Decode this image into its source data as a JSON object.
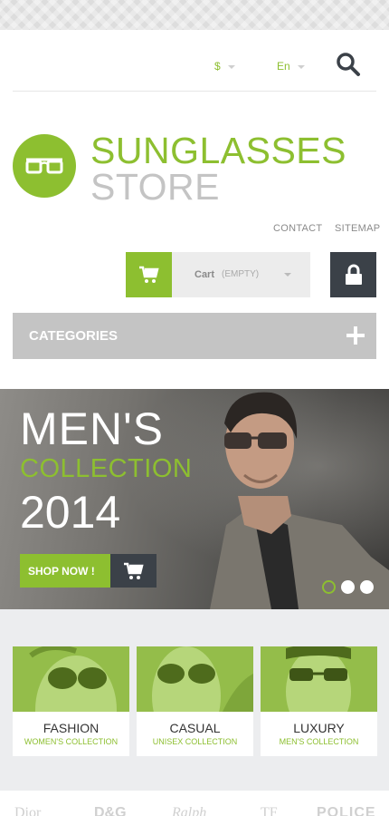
{
  "header": {
    "currency": "$",
    "language": "En"
  },
  "logo": {
    "line1": "SUNGLASSES",
    "line2": "STORE"
  },
  "links": {
    "contact": "CONTACT",
    "sitemap": "SITEMAP"
  },
  "cart": {
    "label": "Cart",
    "status": "(EMPTY)"
  },
  "categories": {
    "label": "CATEGORIES"
  },
  "banner": {
    "line1": "MEN'S",
    "line2": "COLLECTION",
    "line3": "2014",
    "button": "SHOP NOW !"
  },
  "collections": [
    {
      "name": "FASHION",
      "sub": "WOMEN'S COLLECTION"
    },
    {
      "name": "CASUAL",
      "sub": "UNISEX COLLECTION"
    },
    {
      "name": "LUXURY",
      "sub": "MEN'S COLLECTION"
    }
  ],
  "brands": [
    "Dior",
    "D&G",
    "Ralph",
    "TF",
    "POLICE"
  ],
  "colors": {
    "accent": "#8dbf30",
    "dark": "#3b4148",
    "gray": "#c4c4c4"
  }
}
